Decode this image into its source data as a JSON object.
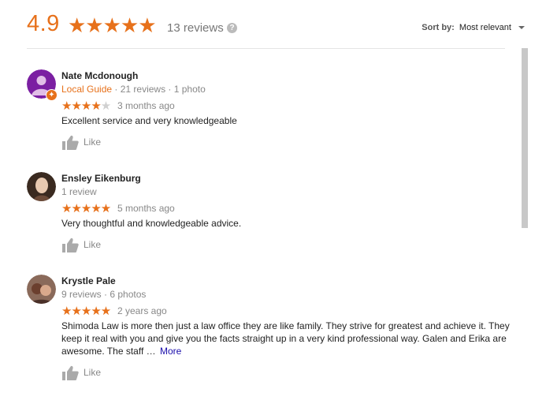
{
  "summary": {
    "rating": "4.9",
    "stars": "★★★★★",
    "count_text": "13 reviews",
    "help_symbol": "?"
  },
  "sort": {
    "label": "Sort by:",
    "value": "Most relevant"
  },
  "colors": {
    "accent": "#e7711b",
    "link": "#1a0dab"
  },
  "reviews": [
    {
      "name": "Nate Mcdonough",
      "guide": "Local Guide",
      "meta": " · 21 reviews · 1 photo",
      "stars_on": "★★★★",
      "stars_off": "★",
      "time": "3 months ago",
      "text": "Excellent service and very knowledgeable",
      "like": "Like"
    },
    {
      "name": "Ensley Eikenburg",
      "meta": "1 review",
      "stars_on": "★★★★★",
      "time": "5 months ago",
      "text": "Very thoughtful and knowledgeable advice.",
      "like": "Like"
    },
    {
      "name": "Krystle Pale",
      "meta": "9 reviews · 6 photos",
      "stars_on": "★★★★★",
      "time": "2 years ago",
      "text": "Shimoda Law is more then just a law office they are like family. They strive for greatest and achieve it. They keep it real with you and give you the facts straight up in a very kind professional way.  Galen and Erika are awesome. The staff …",
      "more": "More",
      "like": "Like"
    }
  ]
}
